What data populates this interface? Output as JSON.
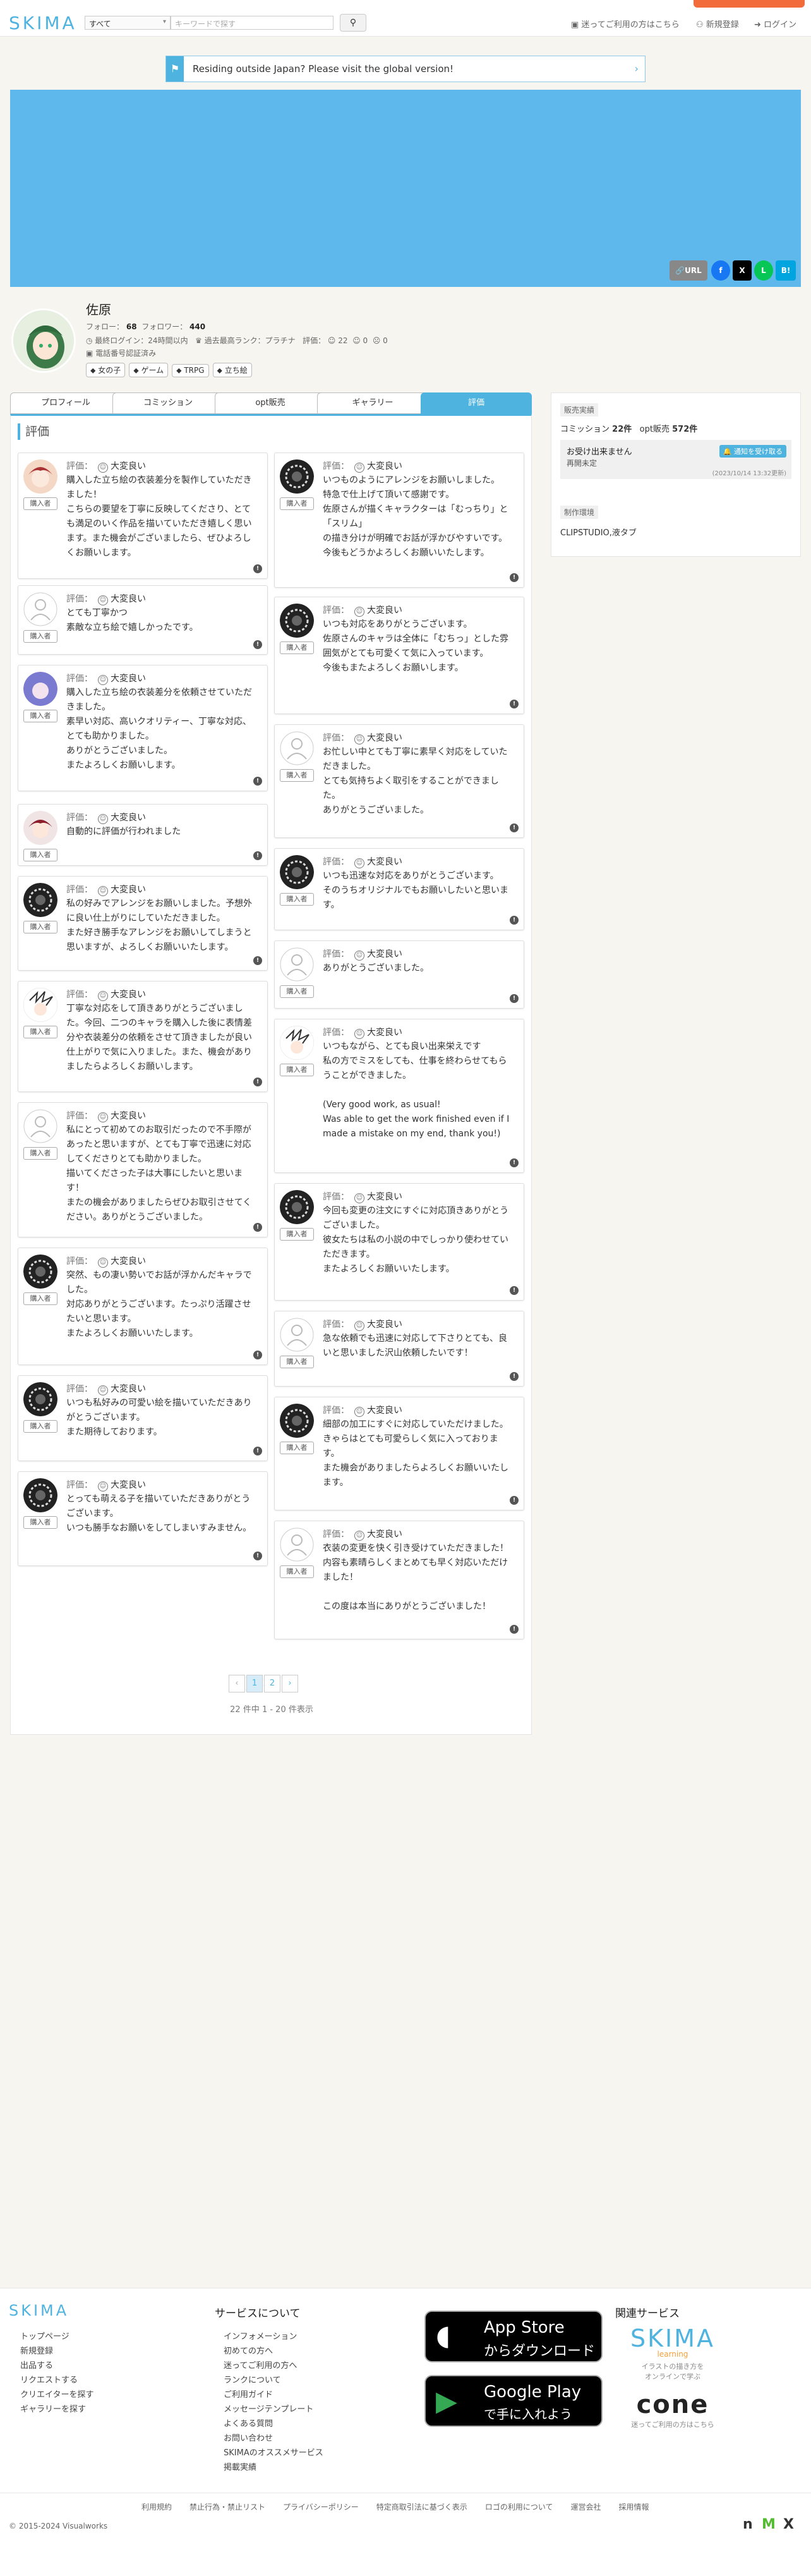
{
  "header": {
    "logo": "SKIMA",
    "search_scope": "すべて",
    "search_placeholder": "キーワードで探す",
    "links": [
      "迷ってご利用の方はこちら",
      "新規登録",
      "ログイン"
    ]
  },
  "notice": {
    "text": "Residing outside Japan? Please visit the global version!"
  },
  "share": {
    "url_label": "URL",
    "fb": "f",
    "x": "X",
    "line": "L",
    "hatena": "B!"
  },
  "profile": {
    "name": "佐原",
    "follow_label": "フォロー",
    "follow_count": "68",
    "follower_label": "フォロワー",
    "follower_count": "440",
    "last_login": "最終ログイン：24時間以内",
    "rank": "過去最高ランク：プラチナ",
    "rating_label": "評価：",
    "rating_good": "22",
    "rating_normal": "0",
    "rating_bad": "0",
    "phone_verified": "電話番号認証済み",
    "tags": [
      "女の子",
      "ゲーム",
      "TRPG",
      "立ち絵"
    ]
  },
  "tabs": [
    "プロフィール",
    "コミッション",
    "opt販売",
    "ギャラリー",
    "評価"
  ],
  "section_title": "評価",
  "review_head": {
    "label": "評価：",
    "value": "大変良い"
  },
  "buyer_label": "購入者",
  "reviews_left": [
    {
      "text": "購入した立ち絵の衣装差分を製作していただきました！\nこちらの要望を丁寧に反映してくださり、とても満足のいく作品を描いていただき嬉しく思います。また機会がございましたら、ぜひよろしくお願いします。"
    },
    {
      "text": "とても丁寧かつ\n素敵な立ち絵で嬉しかったです。"
    },
    {
      "text": "購入した立ち絵の衣装差分を依頼させていただきました。\n素早い対応、高いクオリティー、丁寧な対応、とても助かりました。\nありがとうございました。\nまたよろしくお願いします。"
    },
    {
      "text": "自動的に評価が行われました"
    },
    {
      "text": "私の好みでアレンジをお願いしました。予想外に良い仕上がりにしていただきました。\nまた好き勝手なアレンジをお願いしてしまうと思いますが、よろしくお願いいたします。"
    },
    {
      "text": "丁寧な対応をして頂きありがとうございました。今回、二つのキャラを購入した後に表情差分や衣装差分の依頼をさせて頂きましたが良い仕上がりで気に入りました。また、機会がありましたらよろしくお願いします。"
    },
    {
      "text": "私にとって初めてのお取引だったので不手際があったと思いますが、とても丁寧で迅速に対応してくださりとても助かりました。\n描いてくださった子は大事にしたいと思います！\nまたの機会がありましたらぜひお取引させてください。ありがとうございました。"
    },
    {
      "text": "突然、もの凄い勢いでお話が浮かんだキャラでした。\n対応ありがとうございます。たっぷり活躍させたいと思います。\nまたよろしくお願いいたします。"
    },
    {
      "text": "いつも私好みの可愛い絵を描いていただきありがとうございます。\nまた期待しております。"
    },
    {
      "text": "とっても萌える子を描いていただきありがとうございます。\nいつも勝手なお願いをしてしまいすみません。"
    }
  ],
  "reviews_right": [
    {
      "text": "いつものようにアレンジをお願いしました。\n特急で仕上げて頂いて感謝です。\n佐原さんが描くキャラクターは「むっちり」と「スリム」\nの描き分けが明確でお話が浮かびやすいです。\n今後もどうかよろしくお願いいたします。"
    },
    {
      "text": "いつも対応をありがとうございます。\n佐原さんのキャラは全体に「むちっ」とした雰囲気がとても可愛くて気に入っています。\n今後もまたよろしくお願いします。"
    },
    {
      "text": "お忙しい中とても丁寧に素早く対応をしていただきました。\nとても気持ちよく取引をすることができました。\nありがとうございました。"
    },
    {
      "text": "いつも迅速な対応をありがとうございます。\nそのうちオリジナルでもお願いしたいと思います。"
    },
    {
      "text": "ありがとうございました。"
    },
    {
      "text": "いつもながら、とても良い出来栄えです\n私の方でミスをしても、仕事を終わらせてもらうことができました。\n\n(Very good work, as usual!\nWas able to get the work finished even if I made a mistake on my end, thank you!)"
    },
    {
      "text": "今回も変更の注文にすぐに対応頂きありがとうございました。\n彼女たちは私の小説の中でしっかり使わせていただきます。\nまたよろしくお願いいたします。"
    },
    {
      "text": "急な依頼でも迅速に対応して下さりとても、良いと思いました沢山依頼したいです！"
    },
    {
      "text": "細部の加工にすぐに対応していただけました。\nきゃらはとても可愛らしく気に入っております。\nまた機会がありましたらよろしくお願いいたします。"
    },
    {
      "text": "衣装の変更を快く引き受けていただきました！\n内容も素晴らしくまとめても早く対応いただけました！\n\nこの度は本当にありがとうございました！"
    }
  ],
  "pagination": {
    "prev": "‹",
    "pages": [
      "1",
      "2"
    ],
    "next": "›",
    "summary": "22 件中 1 - 20 件表示"
  },
  "sidebar": {
    "sales_label": "販売実績",
    "commission_label": "コミッション",
    "commission_count": "22件",
    "opt_label": "opt販売",
    "opt_count": "572件",
    "status_title": "お受け出来ません",
    "status_sub": "再開未定",
    "notify_button": "通知を受け取る",
    "updated": "(2023/10/14 13:32更新)",
    "env_label": "制作環境",
    "env_value": "CLIPSTUDIO,液タブ"
  },
  "footer": {
    "logo": "SKIMA",
    "col1": [
      "トップページ",
      "新規登録",
      "出品する",
      "リクエストする",
      "クリエイターを探す",
      "ギャラリーを探す"
    ],
    "service_title": "サービスについて",
    "col2": [
      "インフォメーション",
      "初めての方へ",
      "迷ってご利用の方へ",
      "ランクについて",
      "ご利用ガイド",
      "メッセージテンプレート",
      "よくある質問",
      "お問い合わせ",
      "SKIMAのオススメサービス",
      "掲載実績"
    ],
    "appstore_small": "App Store",
    "appstore_big": "からダウンロード",
    "googleplay_small": "Google Play",
    "googleplay_big": "で手に入れよう",
    "related_title": "関連サービス",
    "learning_logo": "SKIMA",
    "learning_sub": "learning",
    "learning_desc": "イラストの描き方を\nオンラインで学ぶ",
    "cone_logo": "cone",
    "cone_desc": "迷ってご利用の方はこちら",
    "bottom_links": [
      "利用規約",
      "禁止行為・禁止リスト",
      "プライバシーポリシー",
      "特定商取引法に基づく表示",
      "ロゴの利用について",
      "運営会社",
      "採用情報"
    ],
    "copyright": "© 2015-2024 Visualworks"
  }
}
